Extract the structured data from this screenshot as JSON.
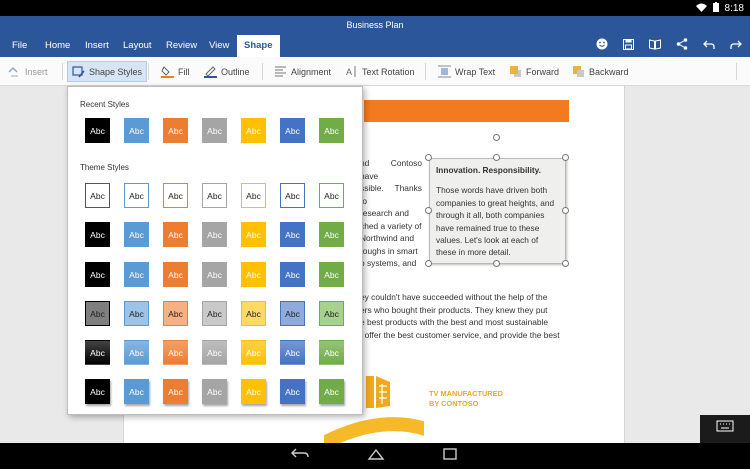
{
  "status_bar": {
    "time": "8:18"
  },
  "app_title": "Business Plan",
  "menu": {
    "tabs": [
      {
        "label": "File"
      },
      {
        "label": "Home"
      },
      {
        "label": "Insert"
      },
      {
        "label": "Layout"
      },
      {
        "label": "Review"
      },
      {
        "label": "View"
      },
      {
        "label": "Shape",
        "active": true
      }
    ],
    "right_icons": [
      "smiley-icon",
      "save-icon",
      "read-mode-icon",
      "share-icon",
      "undo-icon",
      "redo-icon"
    ]
  },
  "ribbon": {
    "insert": "Insert",
    "shape_styles": "Shape Styles",
    "fill": "Fill",
    "outline": "Outline",
    "alignment": "Alignment",
    "text_rotation": "Text Rotation",
    "wrap_text": "Wrap Text",
    "forward": "Forward",
    "backward": "Backward"
  },
  "style_panel": {
    "recent_title": "Recent Styles",
    "theme_title": "Theme Styles",
    "swatch_label": "Abc",
    "colors": [
      "#000000",
      "#5b9bd5",
      "#ed7d31",
      "#a5a5a5",
      "#ffc000",
      "#4472c4",
      "#70ad47"
    ],
    "light_colors": [
      "#7f7f7f",
      "#9dc3e6",
      "#f4b183",
      "#c9c9c9",
      "#ffd966",
      "#8faadc",
      "#a9d18e"
    ]
  },
  "document": {
    "para1": [
      "nd Contoso have",
      "ssible. Thanks to",
      "research and",
      "ched a variety of",
      "Northwind and",
      "roughs in smart",
      "o systems, and"
    ],
    "callout_title": "Innovation. Responsibility.",
    "callout_body": "Those words have driven both companies to great heights, and through it all, both companies have remained true to these values. Let's look at each of these in more detail.",
    "para2": [
      "ey couldn't have succeeded without the help of the",
      "ers who bought their products. They knew they put",
      "e best products with the best and most sustainable",
      ", offer the best customer service, and provide the best"
    ],
    "tv_line1": "TV MANUFACTURED",
    "tv_line2": "BY CONTOSO"
  }
}
